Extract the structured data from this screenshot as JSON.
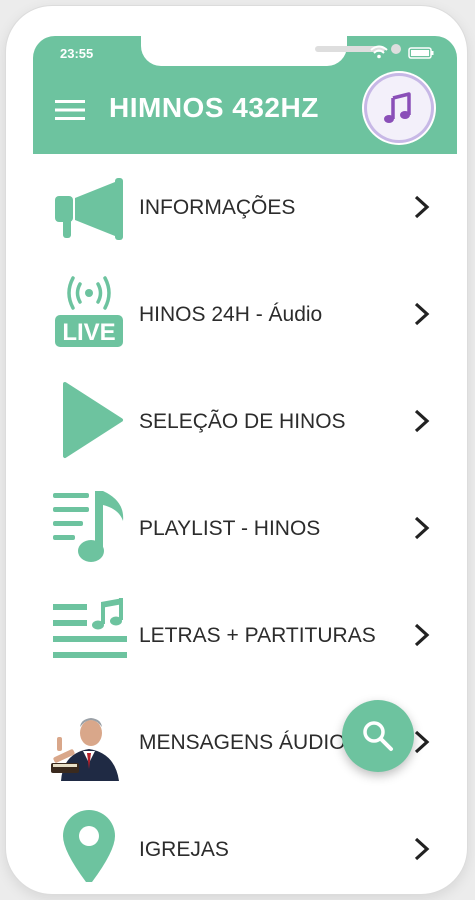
{
  "status_bar": {
    "time": "23:55"
  },
  "app_bar": {
    "title": "HIMNOS 432HZ"
  },
  "colors": {
    "accent": "#6dc39f",
    "text": "#2c2c2c",
    "chevron": "#222222"
  },
  "menu": {
    "items": [
      {
        "label": "INFORMAÇÕES",
        "icon": "megaphone-icon"
      },
      {
        "label": "HINOS 24H - Áudio",
        "icon": "live-broadcast-icon",
        "icon_text": "LIVE"
      },
      {
        "label": "SELEÇÃO DE HINOS",
        "icon": "play-icon"
      },
      {
        "label": "PLAYLIST - HINOS",
        "icon": "playlist-music-note-icon"
      },
      {
        "label": "LETRAS + PARTITURAS",
        "icon": "lyrics-sheet-music-icon"
      },
      {
        "label": "MENSAGENS ÁUDIOS",
        "icon": "preacher-photo"
      },
      {
        "label": "IGREJAS",
        "icon": "location-pin-icon"
      }
    ]
  },
  "fab": {
    "icon": "search-icon"
  }
}
